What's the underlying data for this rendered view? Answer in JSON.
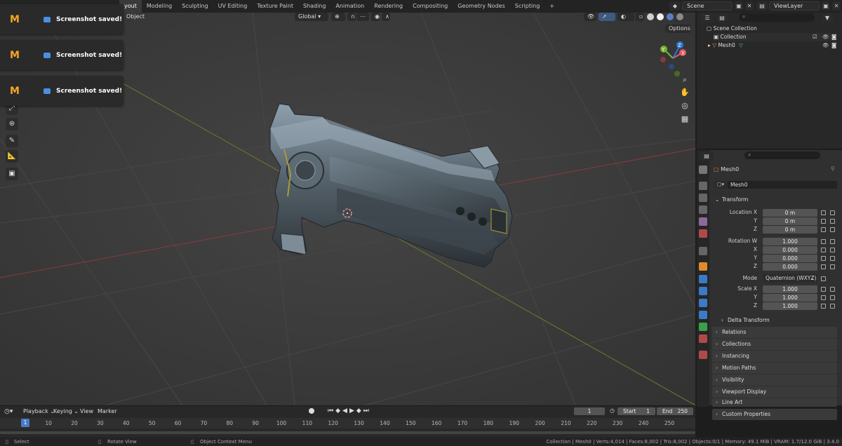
{
  "menu": {
    "tabs": [
      "yout",
      "Modeling",
      "Sculpting",
      "UV Editing",
      "Texture Paint",
      "Shading",
      "Animation",
      "Rendering",
      "Compositing",
      "Geometry Nodes",
      "Scripting"
    ],
    "active_tab": "yout",
    "add_tab": "+"
  },
  "top_right": {
    "scene": "Scene",
    "view_layer": "ViewLayer"
  },
  "viewport": {
    "header_object": "Object",
    "orientation": "Global",
    "options": "Options"
  },
  "toasts": [
    {
      "message": "Screenshot saved!"
    },
    {
      "message": "Screenshot saved!"
    },
    {
      "message": "Screenshot saved!"
    }
  ],
  "outliner": {
    "root": "Scene Collection",
    "items": [
      {
        "label": "Collection"
      },
      {
        "label": "Mesh0"
      }
    ]
  },
  "properties": {
    "object_name": "Mesh0",
    "data_name": "Mesh0",
    "section_transform": "Transform",
    "location": {
      "label": "Location X",
      "x": "0 m",
      "y": "0 m",
      "z": "0 m"
    },
    "rotation": {
      "label": "Rotation W",
      "w": "1.000",
      "x": "0.000",
      "y": "0.000",
      "z": "0.000"
    },
    "mode_label": "Mode",
    "mode_value": "Quaternion (WXYZ)",
    "scale": {
      "label": "Scale X",
      "x": "1.000",
      "y": "1.000",
      "z": "1.000"
    },
    "axis_y": "Y",
    "axis_z": "Z",
    "axis_x": "X",
    "delta_transform": "Delta Transform",
    "panels": [
      "Relations",
      "Collections",
      "Instancing",
      "Motion Paths",
      "Visibility",
      "Viewport Display",
      "Line Art",
      "Custom Properties"
    ]
  },
  "timeline": {
    "menus": [
      "Playback",
      "Keying",
      "View",
      "Marker"
    ],
    "current_frame": "1",
    "start_label": "Start",
    "start_value": "1",
    "end_label": "End",
    "end_value": "250",
    "ticks": [
      "10",
      "20",
      "30",
      "40",
      "50",
      "60",
      "70",
      "80",
      "90",
      "100",
      "110",
      "120",
      "130",
      "140",
      "150",
      "160",
      "170",
      "180",
      "190",
      "200",
      "210",
      "220",
      "230",
      "240",
      "250"
    ],
    "playhead_label": "1"
  },
  "status": {
    "select": "Select",
    "rotate": "Rotate View",
    "context": "Object Context Menu",
    "stats": "Collection | Mesh0 | Verts:4,014 | Faces:8,002 | Tris:8,002 | Objects:0/1 | Memory: 49.1 MiB | VRAM: 1.7/12.0 GiB | 3.4.0"
  }
}
